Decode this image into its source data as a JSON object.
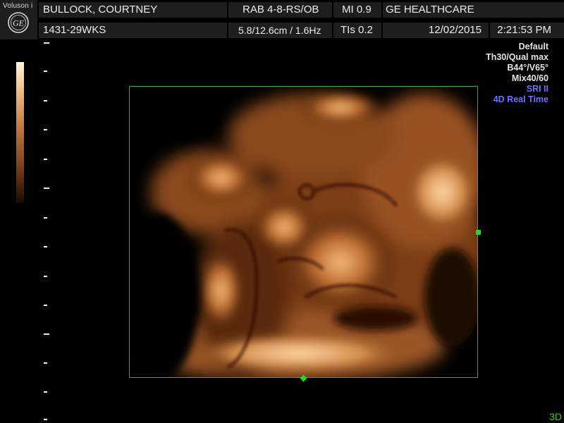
{
  "header": {
    "brand": "Voluson i",
    "logo_text": "GE",
    "patient_name": "BULLOCK, COURTNEY",
    "patient_id": "1431-29WKS",
    "probe": "RAB 4-8-RS/OB",
    "depth_freq": "5.8/12.6cm / 1.6Hz",
    "mi": "MI  0.9",
    "tis": "TIs  0.2",
    "manufacturer": "GE HEALTHCARE",
    "date": "12/02/2015",
    "time": "2:21:53 PM"
  },
  "settings": {
    "line1": "Default",
    "line2": "Th30/Qual max",
    "line3": "B44°/V65°",
    "line4": "Mix40/60",
    "line5": "SRI II",
    "line6": "4D Real Time"
  },
  "mode_label": "3D",
  "colors": {
    "header_bg": "#1e1e1e",
    "roi_border": "#3fa83f",
    "handle": "#27d527",
    "accent_blue": "#6c72ff",
    "mode_green": "#2fcf2f"
  },
  "image": {
    "description_icon": "ultrasound-3d-render",
    "palette": "sepia"
  }
}
